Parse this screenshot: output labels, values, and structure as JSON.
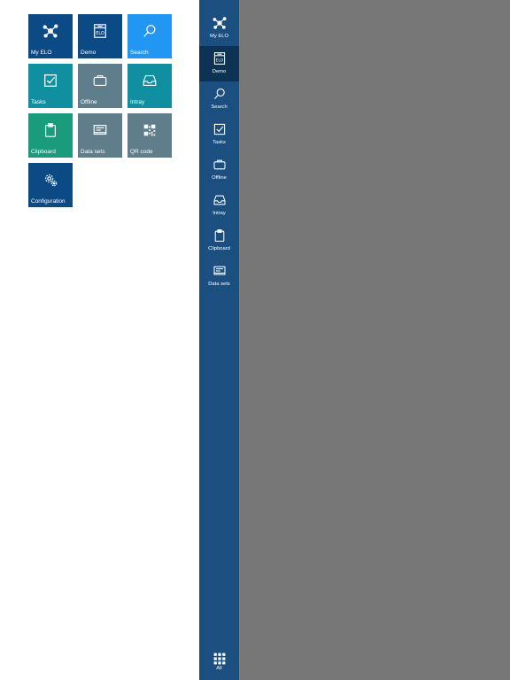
{
  "colors": {
    "tile_navy": "#0b4a85",
    "tile_blue": "#2196f3",
    "tile_teal": "#0f8fa0",
    "tile_gray": "#5f7d8b",
    "tile_green": "#1a9b7b",
    "rail_bg": "#1a4f80",
    "rail_active": "#0d3354",
    "overlay": "#777777"
  },
  "tiles": [
    {
      "label": "My ELO",
      "icon": "network-icon"
    },
    {
      "label": "Demo",
      "icon": "elo-cabinet-icon"
    },
    {
      "label": "Search",
      "icon": "search-icon"
    },
    {
      "label": "Tasks",
      "icon": "checkbox-icon"
    },
    {
      "label": "Offline",
      "icon": "briefcase-icon"
    },
    {
      "label": "Intray",
      "icon": "inbox-tray-icon"
    },
    {
      "label": "Clipboard",
      "icon": "clipboard-icon"
    },
    {
      "label": "Data sets",
      "icon": "data-sets-icon"
    },
    {
      "label": "QR code",
      "icon": "qr-code-icon"
    },
    {
      "label": "Configuration",
      "icon": "gear-icon"
    }
  ],
  "sidebar": {
    "items": [
      {
        "label": "My ELO",
        "icon": "network-icon"
      },
      {
        "label": "Demo",
        "icon": "elo-cabinet-icon",
        "active": true
      },
      {
        "label": "Search",
        "icon": "search-icon"
      },
      {
        "label": "Tasks",
        "icon": "checkbox-icon"
      },
      {
        "label": "Offline",
        "icon": "briefcase-icon"
      },
      {
        "label": "Intray",
        "icon": "inbox-tray-icon"
      },
      {
        "label": "Clipboard",
        "icon": "clipboard-icon"
      },
      {
        "label": "Data sets",
        "icon": "data-sets-icon"
      }
    ],
    "all_button": {
      "label": "All",
      "icon": "grid-icon"
    }
  }
}
